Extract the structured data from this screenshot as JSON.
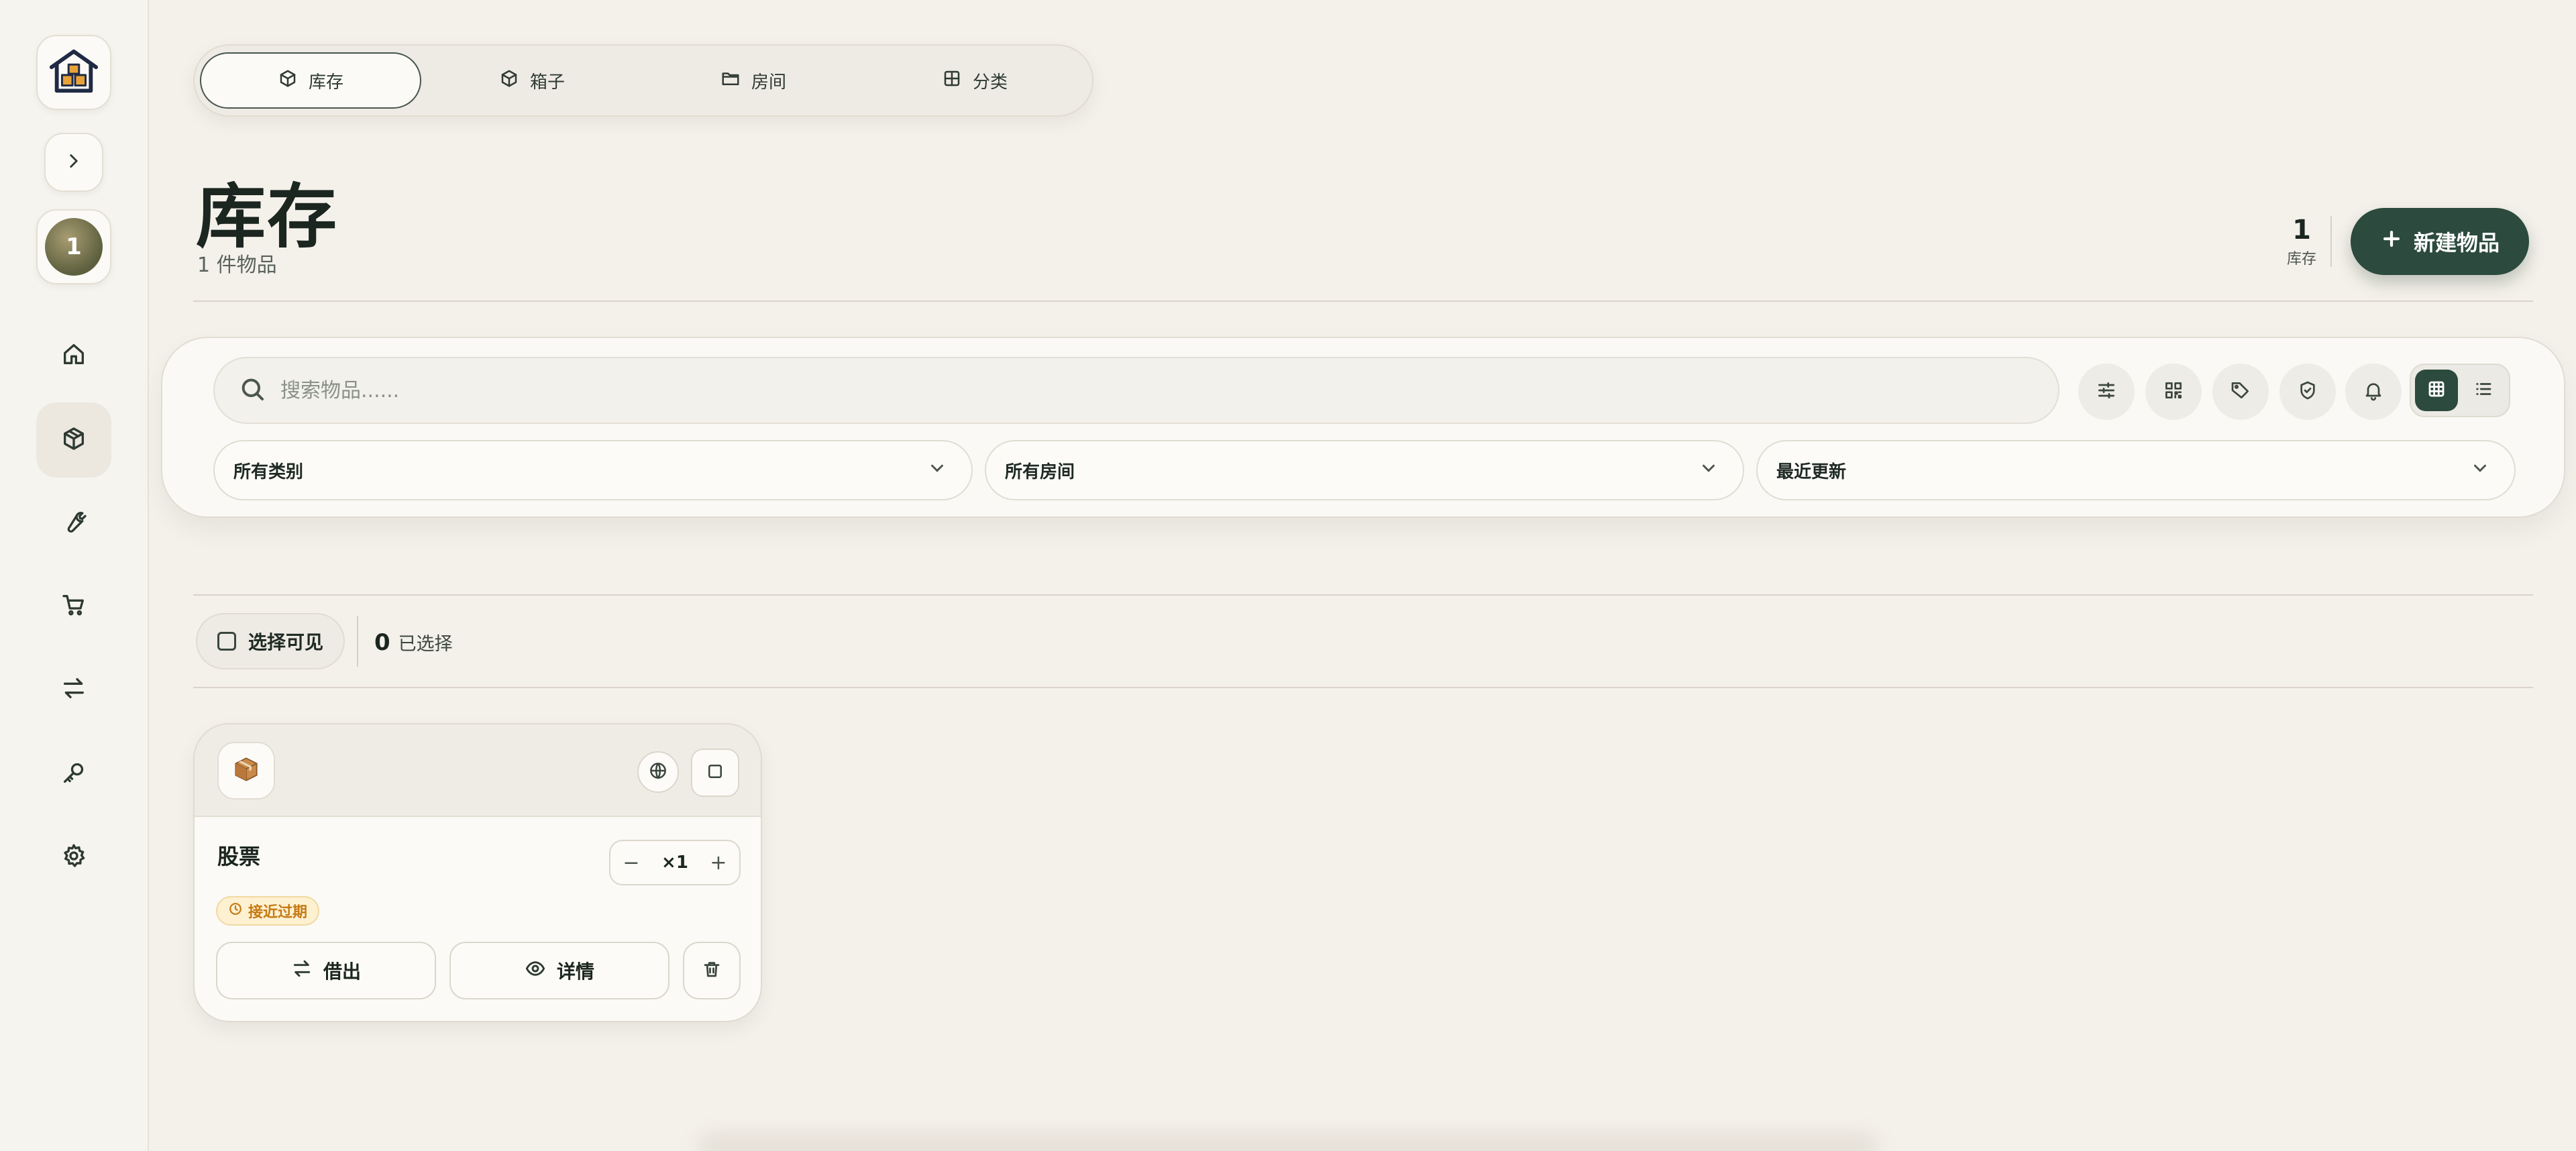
{
  "sidebar": {
    "logo_icon": "warehouse-icon",
    "collapse_icon": "chevron-right-icon",
    "user_avatar_initial": "1",
    "nav": [
      {
        "icon": "home-icon",
        "name": "sidebar-item-home"
      },
      {
        "icon": "box-icon",
        "name": "sidebar-item-inventory",
        "active": true
      },
      {
        "icon": "wrench-icon",
        "name": "sidebar-item-tools"
      },
      {
        "icon": "cart-icon",
        "name": "sidebar-item-shopping"
      },
      {
        "icon": "swap-icon",
        "name": "sidebar-item-lending"
      },
      {
        "icon": "key-icon",
        "name": "sidebar-item-keys"
      },
      {
        "icon": "gear-icon",
        "name": "sidebar-item-settings"
      }
    ]
  },
  "tabs": [
    {
      "label": "库存",
      "icon": "box-icon",
      "active": true
    },
    {
      "label": "箱子",
      "icon": "box-icon"
    },
    {
      "label": "房间",
      "icon": "folder-icon"
    },
    {
      "label": "分类",
      "icon": "grid-icon"
    }
  ],
  "header": {
    "title": "库存",
    "subtitle": "1 件物品",
    "stat_value": "1",
    "stat_label": "库存",
    "new_button_label": "新建物品"
  },
  "filters": {
    "search_placeholder": "搜索物品......",
    "tools": [
      "sliders-icon",
      "qr-code-icon",
      "tag-icon",
      "shield-check-icon",
      "bell-icon"
    ],
    "view_modes": [
      {
        "icon": "grid-view-icon",
        "active": true
      },
      {
        "icon": "list-view-icon"
      }
    ],
    "category_select": "所有类别",
    "room_select": "所有房间",
    "sort_select": "最近更新"
  },
  "selection": {
    "select_visible_label": "选择可见",
    "selected_count": "0",
    "selected_label": "已选择"
  },
  "items": [
    {
      "emoji_icon": "package-icon",
      "name": "股票",
      "quantity": "×1",
      "badge": "接近过期",
      "lend_label": "借出",
      "details_label": "详情"
    }
  ],
  "colors": {
    "accent": "#2c4a3e",
    "background": "#f4f1ea",
    "warning": "#c67a12",
    "warning_bg": "#fdf1d2"
  }
}
